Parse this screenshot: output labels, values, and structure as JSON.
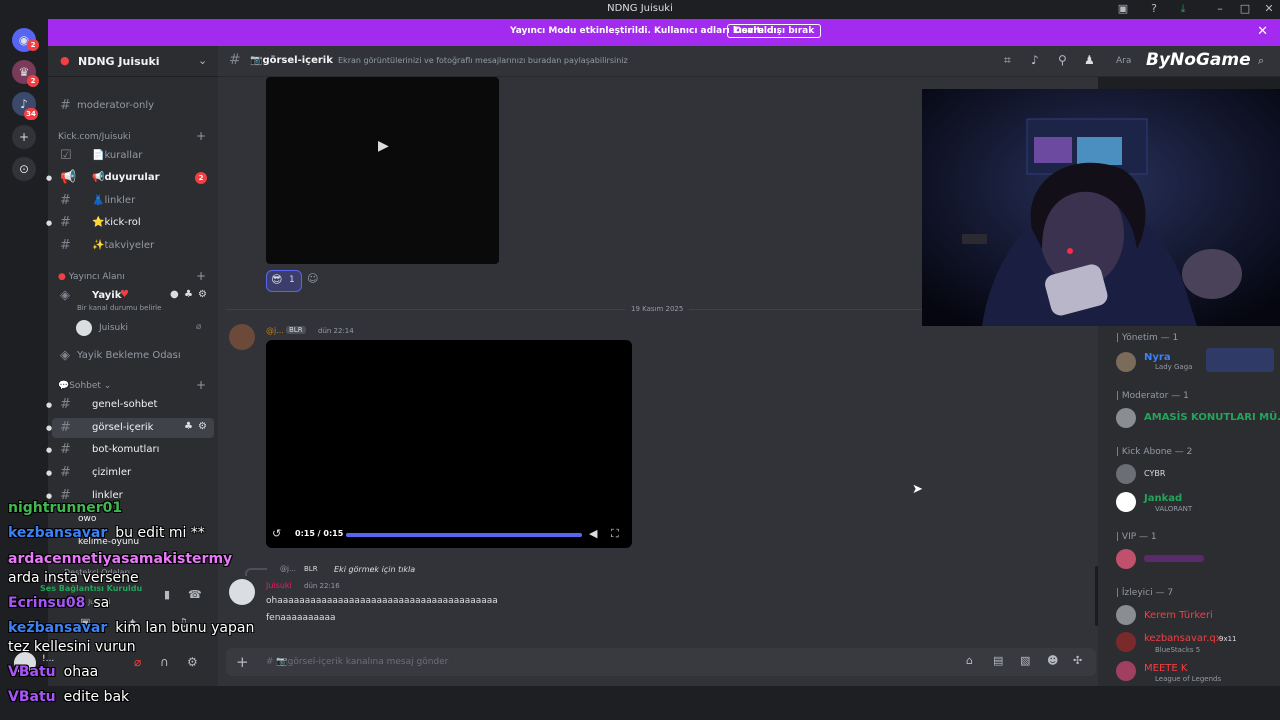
{
  "window": {
    "title": "NDNG Juisuki"
  },
  "banner": {
    "text": "Yayıncı Modu etkinleştirildi. Kullanıcı adları kısaltıldı.",
    "button": "Devre dışı bırak"
  },
  "guilds": {
    "badges": [
      "2",
      "2",
      "34"
    ]
  },
  "server": {
    "name": "NDNG Juisuki"
  },
  "channels": {
    "moderator_only": "moderator-only",
    "cat_kick": "Kick.com/Juisuki",
    "kurallar": "📄kurallar",
    "duyurular": "📢duyurular",
    "duyurular_badge": "2",
    "linkler1": "👗linkler",
    "kick_rol": "⭐kick-rol",
    "takviyeler": "✨takviyeler",
    "cat_yayinci": "Yayıncı Alanı",
    "yayik": "Yayik",
    "kanal_durumu": "Bir kanal durumu belirle",
    "voice_user": "Juisuki",
    "bekleme": "Yayik Bekleme Odası",
    "cat_sohbet": "Sohbet",
    "genel": "genel-sohbet",
    "gorsel": "görsel-içerik",
    "bot": "bot-komutları",
    "cizimler": "çizimler",
    "linkler2": "linkler",
    "owo": "owo",
    "kelime": "kelime-oyunu",
    "destek": "Destekçi Odaları",
    "ses_status": "Ses Bağlantısı Kuruldu",
    "ses_user": "Yayik / NDNG Juisuki",
    "self_user": "!..."
  },
  "topbar": {
    "channel": "📷görsel-içerik",
    "topic": "Ekran görüntülerinizi ve fotoğraflı mesajlarınızı buradan paylaşabilirsiniz",
    "search": "Ara",
    "watermark": "ByNoGame"
  },
  "messages": {
    "reaction_count": "1",
    "date_divider": "19 Kasım 2025",
    "m1_author": "@j...",
    "m1_tag": "BLR",
    "m1_time": "dün 22:14",
    "video_time": "0:15 / 0:15",
    "video_progress": 1.0,
    "reply_author": "@j...",
    "reply_tag": "BLR",
    "reply_text": "Eki görmek için tıkla",
    "m2_author": "Juisuki",
    "m2_time": "dün 22:16",
    "m2_line1": "ohaaaaaaaaaaaaaaaaaaaaaaaaaaaaaaaaaaaaaaaa",
    "m2_line2": "fenaaaaaaaaaa",
    "input_placeholder": "# 📷görsel-içerik kanalına mesaj gönder"
  },
  "members": {
    "g1": "Yönetim — 1",
    "m1_name": "Nyra",
    "m1_status": "Lady Gaga",
    "g2": "Moderator — 1",
    "m2_name": "AMASİS KONUTLARI MÜ...",
    "g3": "Kick Abone — 2",
    "m3_name": "CYBR",
    "m4_name": "Jankad",
    "m4_status": "VALORANT",
    "g4": "VIP — 1",
    "g5": "İzleyici — 7",
    "m5_name": "Kerem Türkeri",
    "m6_name": "kezbansavar.qx",
    "m6_tag": "9x11",
    "m6_status": "BlueStacks 5",
    "m7_name": "MEETE K",
    "m7_status": "League of Legends"
  },
  "overlay_chat": [
    {
      "user": "nightrunner01",
      "msg": "",
      "color": "#3fb950"
    },
    {
      "user": "kezbansavar",
      "msg": "bu edit mi **",
      "color": "#3b82f6"
    },
    {
      "user": "ardacennetiyasamakistermy",
      "msg": "",
      "color": "#e879f9"
    },
    {
      "user": "",
      "msg": "arda insta versene",
      "color": "#ffffff"
    },
    {
      "user": "Ecrinsu08",
      "msg": "sa",
      "color": "#a855f7"
    },
    {
      "user": "kezbansavar",
      "msg": "kim lan bunu yapan",
      "color": "#3b82f6"
    },
    {
      "user": "",
      "msg": "tez kellesini vurun",
      "color": "#ffffff"
    },
    {
      "user": "VBatu",
      "msg": "ohaa",
      "color": "#a855f7"
    },
    {
      "user": "VBatu",
      "msg": "edite bak",
      "color": "#a855f7"
    }
  ],
  "colors": {
    "accent": "#5865f2",
    "banner": "#a32bf0",
    "badge": "#f23f43",
    "online": "#23a55a"
  }
}
